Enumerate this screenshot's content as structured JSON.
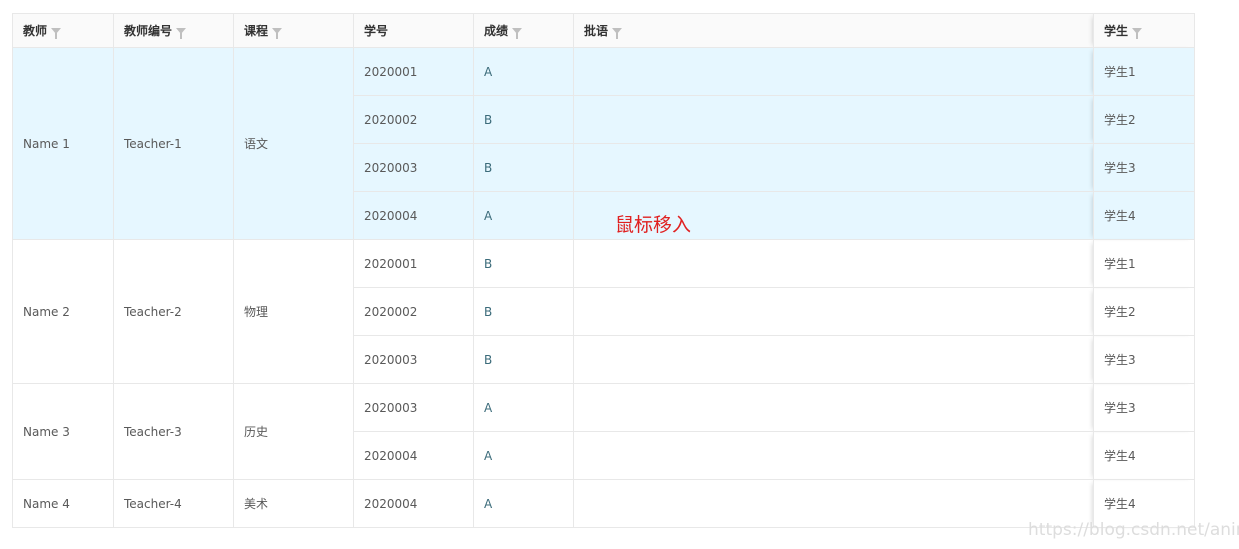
{
  "headers": [
    {
      "label": "教师",
      "filter": true
    },
    {
      "label": "教师编号",
      "filter": true
    },
    {
      "label": "课程",
      "filter": true
    },
    {
      "label": "学号",
      "filter": false
    },
    {
      "label": "成绩",
      "filter": true
    },
    {
      "label": "批语",
      "filter": true
    },
    {
      "label": "学生",
      "filter": true
    }
  ],
  "groups": [
    {
      "teacher": "Name 1",
      "teacher_id": "Teacher-1",
      "course": "语文",
      "rows": [
        {
          "sid": "2020001",
          "grade": "A",
          "student": "学生1"
        },
        {
          "sid": "2020002",
          "grade": "B",
          "student": "学生2"
        },
        {
          "sid": "2020003",
          "grade": "B",
          "student": "学生3"
        },
        {
          "sid": "2020004",
          "grade": "A",
          "student": "学生4"
        }
      ]
    },
    {
      "teacher": "Name 2",
      "teacher_id": "Teacher-2",
      "course": "物理",
      "rows": [
        {
          "sid": "2020001",
          "grade": "B",
          "student": "学生1"
        },
        {
          "sid": "2020002",
          "grade": "B",
          "student": "学生2"
        },
        {
          "sid": "2020003",
          "grade": "B",
          "student": "学生3"
        }
      ]
    },
    {
      "teacher": "Name 3",
      "teacher_id": "Teacher-3",
      "course": "历史",
      "rows": [
        {
          "sid": "2020003",
          "grade": "A",
          "student": "学生3"
        },
        {
          "sid": "2020004",
          "grade": "A",
          "student": "学生4"
        }
      ]
    },
    {
      "teacher": "Name 4",
      "teacher_id": "Teacher-4",
      "course": "美术",
      "rows": [
        {
          "sid": "2020004",
          "grade": "A",
          "student": "学生4"
        }
      ]
    }
  ],
  "annotation": "鼠标移入",
  "watermark": "https://blog.csdn.net/aningde"
}
